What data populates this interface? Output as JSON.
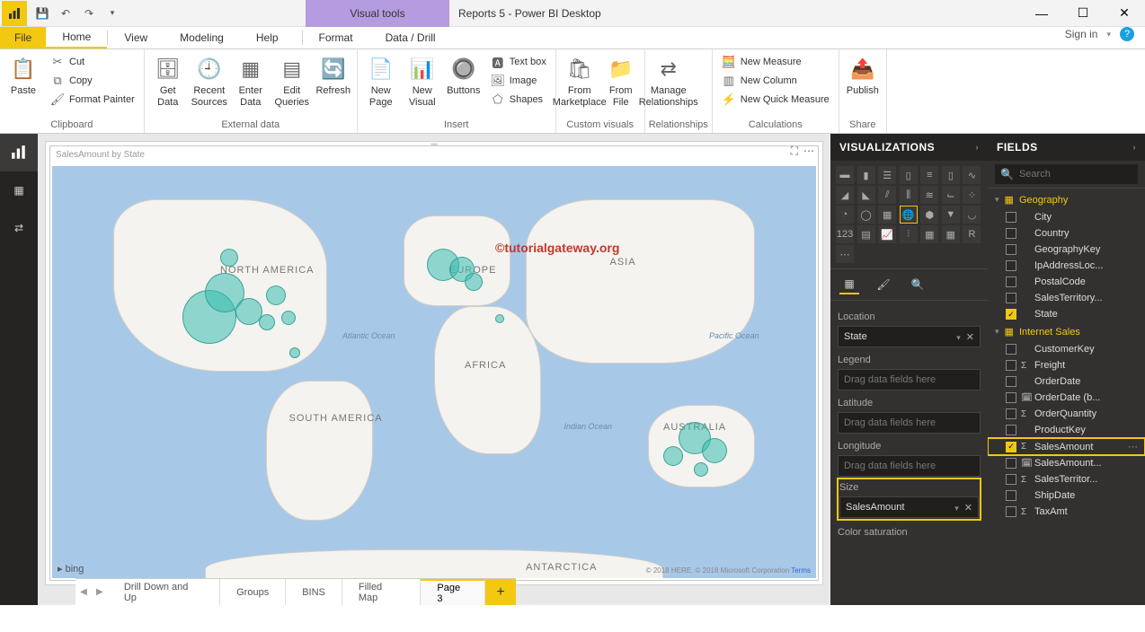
{
  "app": {
    "title": "Reports 5 - Power BI Desktop",
    "contextual_tools": "Visual tools",
    "sign_in": "Sign in"
  },
  "menu": {
    "file": "File",
    "home": "Home",
    "view": "View",
    "modeling": "Modeling",
    "help": "Help",
    "format": "Format",
    "data_drill": "Data / Drill"
  },
  "ribbon": {
    "paste": "Paste",
    "cut": "Cut",
    "copy": "Copy",
    "format_painter": "Format Painter",
    "clipboard": "Clipboard",
    "get_data": "Get Data",
    "recent_sources": "Recent Sources",
    "enter_data": "Enter Data",
    "edit_queries": "Edit Queries",
    "refresh": "Refresh",
    "external_data": "External data",
    "new_page": "New Page",
    "new_visual": "New Visual",
    "buttons": "Buttons",
    "text_box": "Text box",
    "image": "Image",
    "shapes": "Shapes",
    "insert": "Insert",
    "from_marketplace": "From Marketplace",
    "from_file": "From File",
    "custom_visuals": "Custom visuals",
    "manage_relationships": "Manage Relationships",
    "relationships": "Relationships",
    "new_measure": "New Measure",
    "new_column": "New Column",
    "new_quick_measure": "New Quick Measure",
    "calculations": "Calculations",
    "publish": "Publish",
    "share": "Share"
  },
  "visual": {
    "title": "SalesAmount by State",
    "watermark": "©tutorialgateway.org",
    "bing": "bing",
    "attribution_text": "© 2018 HERE. © 2018 Microsoft Corporation",
    "attribution_link": "Terms"
  },
  "map_labels": {
    "na": "NORTH AMERICA",
    "sa": "SOUTH AMERICA",
    "europe": "EUROPE",
    "africa": "AFRICA",
    "asia": "ASIA",
    "australia": "AUSTRALIA",
    "antarctica": "ANTARCTICA",
    "atlantic": "Atlantic Ocean",
    "indian": "Indian Ocean",
    "pacific": "Pacific Ocean"
  },
  "viz_pane": {
    "title": "VISUALIZATIONS",
    "wells": {
      "location": "Location",
      "location_value": "State",
      "legend": "Legend",
      "latitude": "Latitude",
      "longitude": "Longitude",
      "size": "Size",
      "size_value": "SalesAmount",
      "color_sat": "Color saturation",
      "placeholder": "Drag data fields here"
    }
  },
  "fields_pane": {
    "title": "FIELDS",
    "search": "Search",
    "tables": {
      "geography": {
        "name": "Geography",
        "fields": [
          "City",
          "Country",
          "GeographyKey",
          "IpAddressLoc...",
          "PostalCode",
          "SalesTerritory...",
          "State"
        ]
      },
      "internet_sales": {
        "name": "Internet Sales",
        "fields": [
          "CustomerKey",
          "Freight",
          "OrderDate",
          "OrderDate (b...",
          "OrderQuantity",
          "ProductKey",
          "SalesAmount",
          "SalesAmount...",
          "SalesTerritor...",
          "ShipDate",
          "TaxAmt"
        ]
      }
    }
  },
  "pages": {
    "tabs": [
      "Drill Down and Up",
      "Groups",
      "BINS",
      "Filled Map",
      "Page 3"
    ],
    "active": "Page 3"
  }
}
